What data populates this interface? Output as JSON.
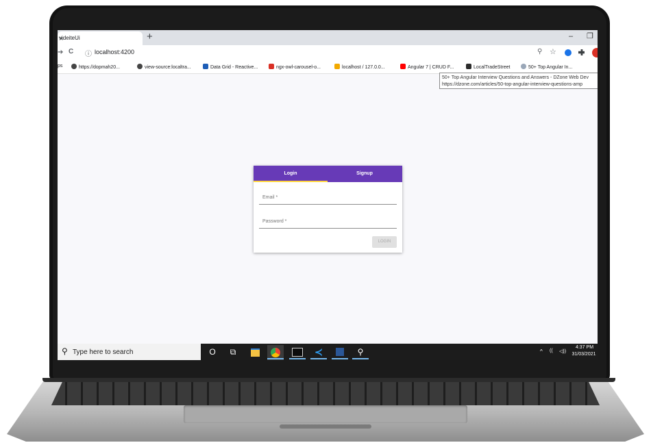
{
  "browser": {
    "tab_title": "videiteUi",
    "tab_close": "×",
    "new_tab": "+",
    "window_min": "–",
    "window_max": "❐",
    "back": "➔",
    "reload": "C",
    "info_icon": "ⓘ",
    "url": "localhost:4200",
    "zoom_icon": "⚲",
    "star_icon": "☆",
    "bookmarks": [
      {
        "label": "ps",
        "icon": "",
        "color": ""
      },
      {
        "label": "https://dopmah20...",
        "icon": "globe-icon",
        "color": "#444444"
      },
      {
        "label": "view-source:localtra...",
        "icon": "globe-icon",
        "color": "#444444"
      },
      {
        "label": "Data Grid - Reactive...",
        "icon": "grid-icon",
        "color": "#1e5eb7"
      },
      {
        "label": "ngx-owl-carousel-o...",
        "icon": "square-icon",
        "color": "#d93025"
      },
      {
        "label": "localhost / 127.0.0...",
        "icon": "pma-icon",
        "color": "#f2a900"
      },
      {
        "label": "Angular 7 | CRUD F...",
        "icon": "youtube-icon",
        "color": "#ff0000"
      },
      {
        "label": "LocalTradeStreet",
        "icon": "angular-icon",
        "color": "#2b2b2b"
      },
      {
        "label": "50+ Top Angular In...",
        "icon": "dzone-icon",
        "color": "#9aa7b8"
      }
    ],
    "tooltip": {
      "line1": "50+ Top Angular Interview Questions and Answers - DZone Web Dev",
      "line2": "https://dzone.com/articles/50-top-angular-interview-questions-amp"
    }
  },
  "login_card": {
    "tab_login": "Login",
    "tab_signup": "Signup",
    "email_label": "Email *",
    "password_label": "Password *",
    "login_button": "LOGIN",
    "accent_color": "#673ab7",
    "ink_color": "#ffd740"
  },
  "taskbar": {
    "search_placeholder": "Type here to search",
    "search_icon": "⚲",
    "cortana_icon": "O",
    "taskview_icon": "⧉",
    "tray_chevron": "^",
    "tray_wifi": "((",
    "tray_volume": "◁))",
    "time": "4:37 PM",
    "date": "31/03/2021"
  }
}
